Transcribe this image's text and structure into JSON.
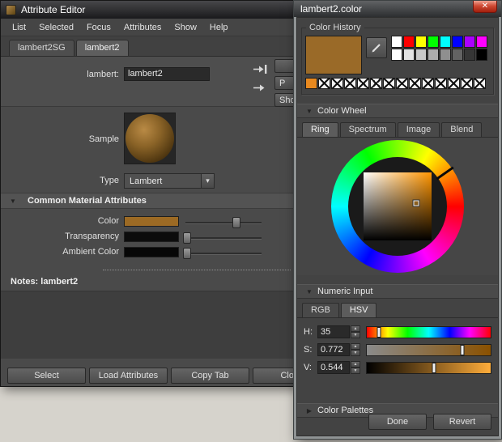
{
  "icons": {
    "close": "✕",
    "dropdown": "▾",
    "expanded": "▼",
    "collapsed": "▶",
    "up": "▲",
    "down": "▼"
  },
  "attribute_editor": {
    "title": "Attribute Editor",
    "menu": [
      "List",
      "Selected",
      "Focus",
      "Attributes",
      "Show",
      "Help"
    ],
    "tabs": [
      "lambert2SG",
      "lambert2"
    ],
    "name_field": {
      "label": "lambert:",
      "value": "lambert2"
    },
    "side_buttons": [
      "",
      "P",
      "Sho"
    ],
    "sample_label": "Sample",
    "type_field": {
      "label": "Type",
      "value": "Lambert"
    },
    "common_section": "Common Material Attributes",
    "attributes": [
      {
        "label": "Color",
        "swatch": "#9c6a24",
        "slider": 0.67
      },
      {
        "label": "Transparency",
        "swatch": "#0c0c0c",
        "slider": 0.02
      },
      {
        "label": "Ambient Color",
        "swatch": "#070707",
        "slider": 0.02
      }
    ],
    "notes_label": "Notes: lambert2",
    "buttons": [
      "Select",
      "Load Attributes",
      "Copy Tab",
      "Close"
    ]
  },
  "color_editor": {
    "title": "lambert2.color",
    "history": {
      "label": "Color History",
      "current": "#9a6a28",
      "palette_row1": [
        "#ffffff",
        "#ff0000",
        "#ffff00",
        "#00ff00",
        "#00ffff",
        "#0000ff",
        "#aa00ff",
        "#ff00ff"
      ],
      "palette_row2": [
        "#ffffff",
        "#e3e3e3",
        "#c8c8c8",
        "#adadad",
        "#8f8f8f",
        "#636363",
        "#363636",
        "#000000"
      ],
      "recent": [
        "#e8891f",
        "x",
        "x",
        "x",
        "x",
        "x",
        "x",
        "x",
        "x",
        "x",
        "x",
        "x",
        "x",
        "x"
      ]
    },
    "wheel": {
      "label": "Color Wheel",
      "tabs": [
        "Ring",
        "Spectrum",
        "Image",
        "Blend"
      ],
      "selected_tab": "Ring",
      "hue": 35,
      "sat": 0.772,
      "val": 0.544
    },
    "numeric": {
      "label": "Numeric Input",
      "tabs": [
        "RGB",
        "HSV"
      ],
      "selected_tab": "HSV",
      "rows": [
        {
          "label": "H:",
          "value": "35"
        },
        {
          "label": "S:",
          "value": "0.772"
        },
        {
          "label": "V:",
          "value": "0.544"
        }
      ]
    },
    "palettes_label": "Color Palettes",
    "buttons": [
      "Done",
      "Revert"
    ]
  }
}
